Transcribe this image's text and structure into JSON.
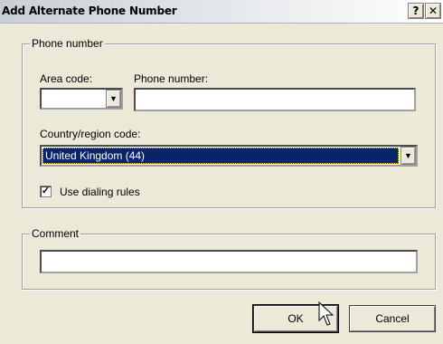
{
  "window": {
    "title": "Add Alternate Phone Number",
    "help_label": "?",
    "close_label": "✕"
  },
  "phone_group": {
    "legend": "Phone number",
    "area_code_label": "Area code:",
    "area_code_value": "",
    "phone_number_label": "Phone number:",
    "phone_number_value": "",
    "country_label": "Country/region code:",
    "country_value": "United Kingdom (44)",
    "use_dialing_rules_label": "Use dialing rules",
    "use_dialing_rules_checked": true
  },
  "comment_group": {
    "legend": "Comment",
    "comment_value": ""
  },
  "buttons": {
    "ok_label": "OK",
    "cancel_label": "Cancel"
  },
  "icons": {
    "dropdown": "chevron-down-icon",
    "check": "checkmark-icon",
    "cursor": "mouse-pointer-icon"
  }
}
